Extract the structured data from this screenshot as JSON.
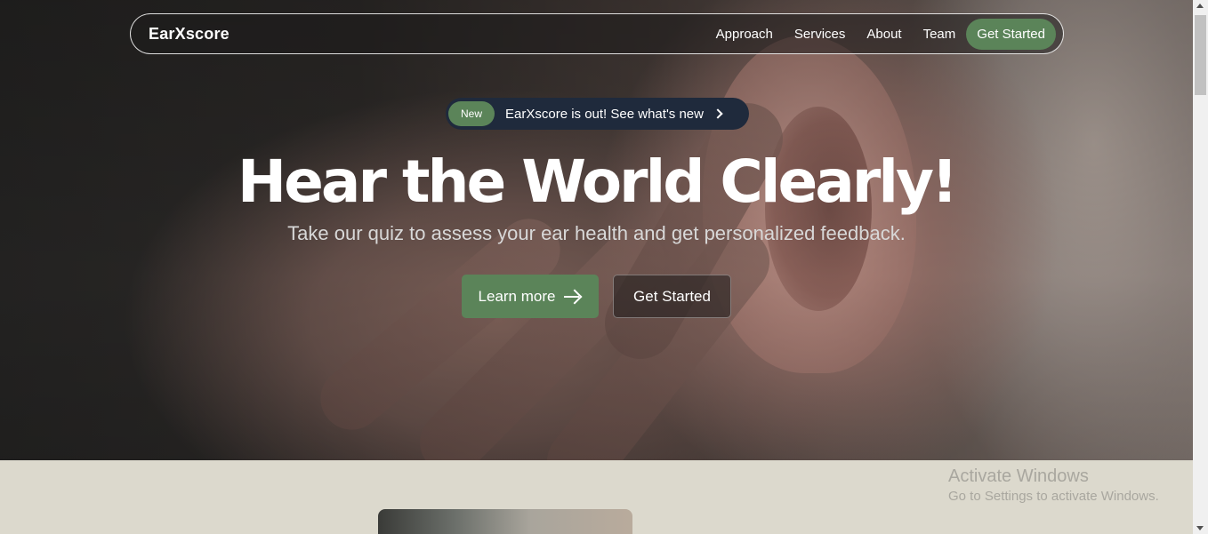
{
  "navbar": {
    "brand": "EarXscore",
    "links": [
      "Approach",
      "Services",
      "About",
      "Team"
    ],
    "cta": "Get Started"
  },
  "announcement": {
    "badge": "New",
    "text": "EarXscore is out! See what's new"
  },
  "hero": {
    "headline": "Hear the World Clearly!",
    "subline": "Take our quiz to assess your ear health and get personalized feedback.",
    "primary_button": "Learn more",
    "secondary_button": "Get Started"
  },
  "watermark": {
    "title": "Activate Windows",
    "subtitle": "Go to Settings to activate Windows."
  },
  "colors": {
    "accent": "#5b8459",
    "announcement_bg": "#1f2a3c",
    "section_bg": "#dcd9cd"
  }
}
